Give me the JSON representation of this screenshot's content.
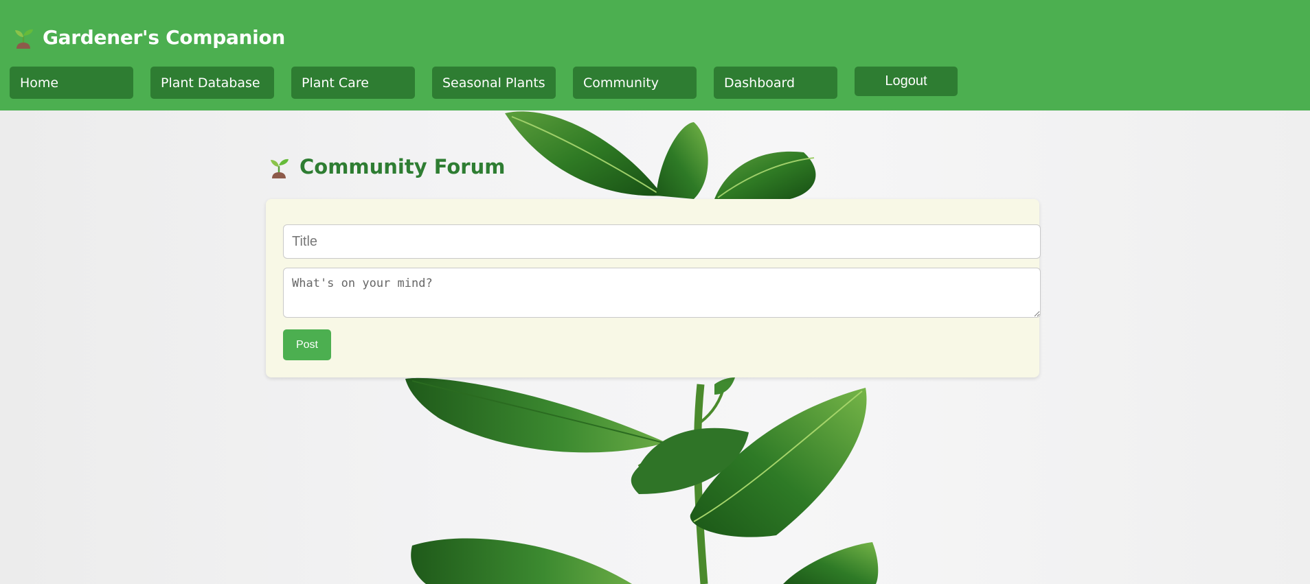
{
  "header": {
    "brand_icon": "seedling-icon",
    "title": "Gardener's Companion"
  },
  "nav": {
    "items": [
      {
        "label": "Home"
      },
      {
        "label": "Plant Database"
      },
      {
        "label": "Plant Care"
      },
      {
        "label": "Seasonal Plants"
      },
      {
        "label": "Community"
      },
      {
        "label": "Dashboard"
      }
    ],
    "logout_label": "Logout"
  },
  "forum": {
    "icon": "seedling-icon",
    "heading": "Community Forum",
    "title_placeholder": "Title",
    "title_value": "",
    "body_placeholder": "What's on your mind?",
    "body_value": "",
    "post_label": "Post"
  },
  "colors": {
    "header_bg": "#4caf50",
    "nav_bg": "#2e7d32",
    "heading_text": "#2e7d32",
    "panel_bg": "#f8f8e6",
    "post_button": "#4caf50"
  }
}
